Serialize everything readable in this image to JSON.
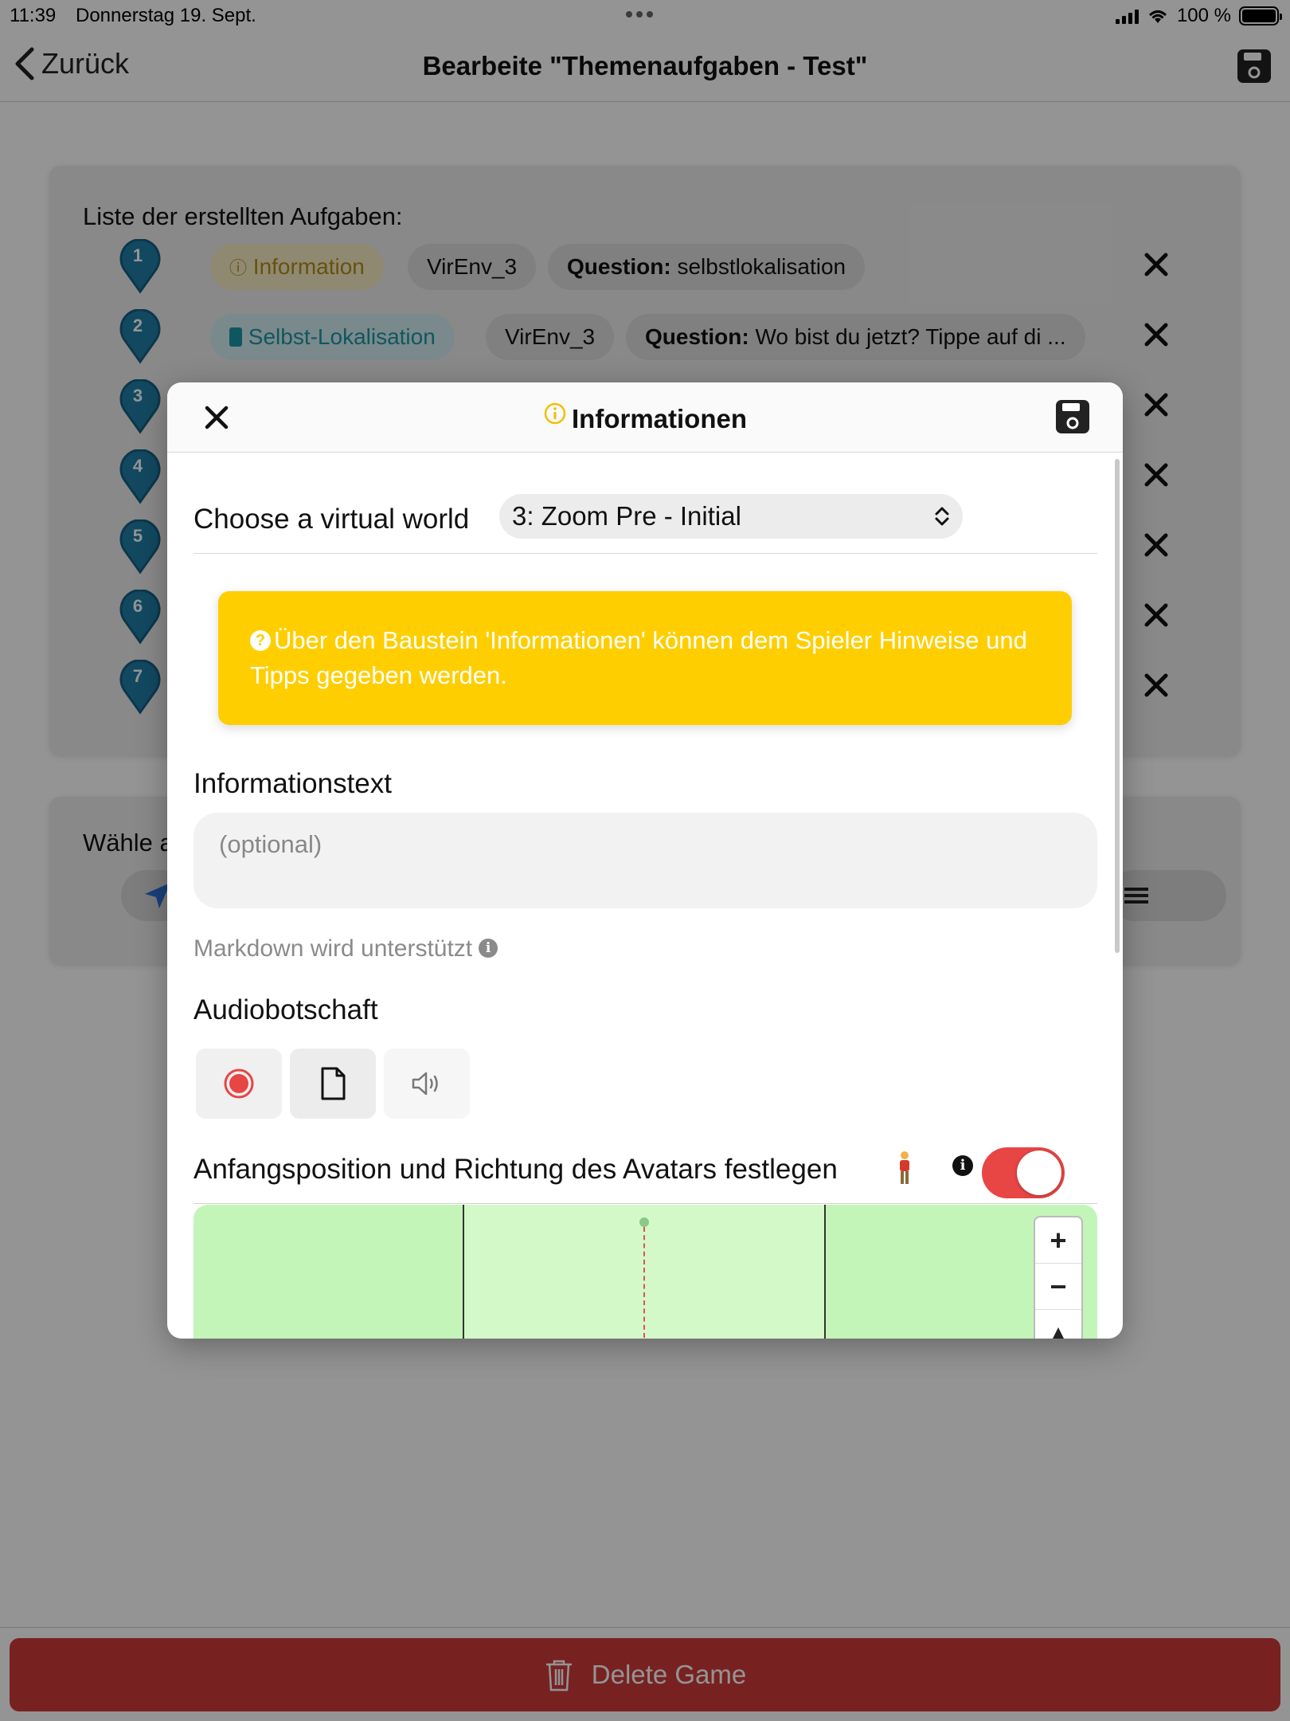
{
  "status_bar": {
    "time": "11:39",
    "date": "Donnerstag 19. Sept.",
    "battery": "100 %"
  },
  "nav": {
    "back_label": "Zurück",
    "title": "Bearbeite \"Themenaufgaben - Test\""
  },
  "task_list": {
    "title": "Liste der erstellten Aufgaben:",
    "rows": [
      {
        "num": "1",
        "type": "Information",
        "world": "VirEnv_3",
        "question_label": "Question:",
        "question": "selbstlokalisation"
      },
      {
        "num": "2",
        "type": "Selbst-Lokalisation",
        "world": "VirEnv_3",
        "question_label": "Question:",
        "question": "Wo bist du jetzt? Tippe auf di ..."
      },
      {
        "num": "3"
      },
      {
        "num": "4"
      },
      {
        "num": "5"
      },
      {
        "num": "6"
      },
      {
        "num": "7"
      }
    ]
  },
  "card2": {
    "title": "Wähle a"
  },
  "footer": {
    "delete_label": "Delete Game"
  },
  "modal": {
    "title": "Informationen",
    "virtual_world_label": "Choose a virtual world",
    "virtual_world_value": "3: Zoom Pre - Initial",
    "hint_text": "Über den Baustein 'Informationen' können dem Spieler Hinweise und Tipps gegeben werden.",
    "info_text_label": "Informationstext",
    "info_text_placeholder": "(optional)",
    "info_text_value": "",
    "markdown_note": "Markdown wird unterstützt",
    "audio_label": "Audiobotschaft",
    "avatar_label": "Anfangsposition und Richtung des Avatars festlegen",
    "avatar_toggle_on": true,
    "zoom_in": "+",
    "zoom_out": "−",
    "compass": "▲"
  },
  "colors": {
    "info_yellow": "#ffce00",
    "selbst_teal": "#1b97a6",
    "pin_blue": "#1f7fa8",
    "danger_red": "#cf3a3a",
    "toggle_red": "#e84545",
    "map_green": "#c3f5b8"
  }
}
